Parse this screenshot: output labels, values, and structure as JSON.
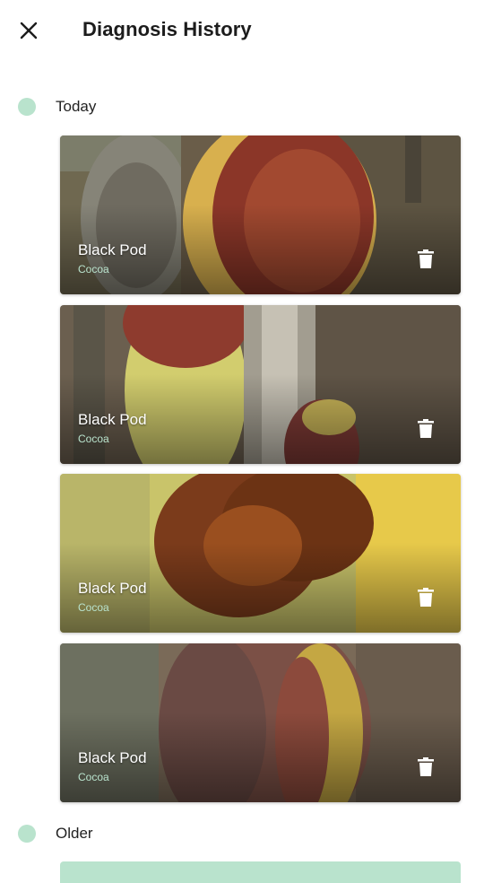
{
  "header": {
    "title": "Diagnosis History",
    "close_icon": "close-icon"
  },
  "colors": {
    "accent_dot": "#b9e3cd",
    "crop_label": "#b9e3cd"
  },
  "sections": [
    {
      "label": "Today",
      "items": [
        {
          "name": "Black Pod",
          "crop": "Cocoa",
          "action_icon": "trash-icon"
        },
        {
          "name": "Black Pod",
          "crop": "Cocoa",
          "action_icon": "trash-icon"
        },
        {
          "name": "Black Pod",
          "crop": "Cocoa",
          "action_icon": "trash-icon"
        },
        {
          "name": "Black Pod",
          "crop": "Cocoa",
          "action_icon": "trash-icon"
        }
      ]
    },
    {
      "label": "Older",
      "items": []
    }
  ]
}
